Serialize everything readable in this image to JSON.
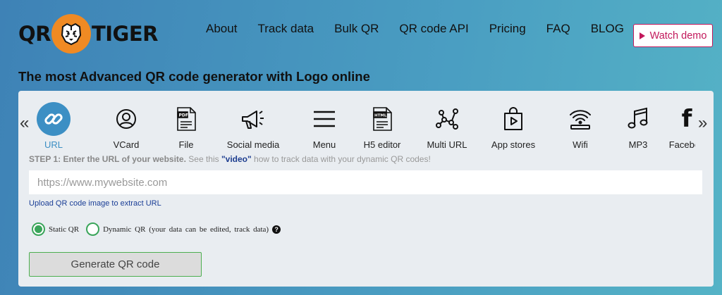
{
  "brand": {
    "logo_left": "QR",
    "logo_right": "TIGER",
    "logo_color": "#f08a23"
  },
  "nav": [
    "About",
    "Track data",
    "Bulk QR",
    "QR code API",
    "Pricing",
    "FAQ",
    "BLOG"
  ],
  "watch_demo": "Watch demo",
  "headline": "The most Advanced QR code generator with Logo online",
  "types": [
    {
      "label": "URL",
      "icon": "link-icon",
      "active": true
    },
    {
      "label": "VCard",
      "icon": "user-icon"
    },
    {
      "label": "File",
      "icon": "pdf-file-icon"
    },
    {
      "label": "Social media",
      "icon": "megaphone-icon"
    },
    {
      "label": "Menu",
      "icon": "menu-icon"
    },
    {
      "label": "H5 editor",
      "icon": "html-file-icon"
    },
    {
      "label": "Multi URL",
      "icon": "network-icon"
    },
    {
      "label": "App stores",
      "icon": "shopping-bag-icon"
    },
    {
      "label": "Wifi",
      "icon": "wifi-icon"
    },
    {
      "label": "MP3",
      "icon": "music-icon"
    },
    {
      "label": "Faceboo",
      "icon": "facebook-icon"
    }
  ],
  "step": {
    "title": "STEP 1: Enter the URL of your website.",
    "pre": " See this ",
    "link": "\"video\"",
    "post": " how to track data with your dynamic QR codes!"
  },
  "url_placeholder": "https://www.mywebsite.com",
  "upload_link": "Upload QR code image to extract URL",
  "radio_static": "Static QR",
  "radio_dynamic": "Dynamic QR (your data can be edited, track data)",
  "help_icon": "?",
  "generate": "Generate QR code",
  "colors": {
    "accent": "#3c8fc4",
    "green": "#3aa55a",
    "demo": "#c2185b"
  }
}
